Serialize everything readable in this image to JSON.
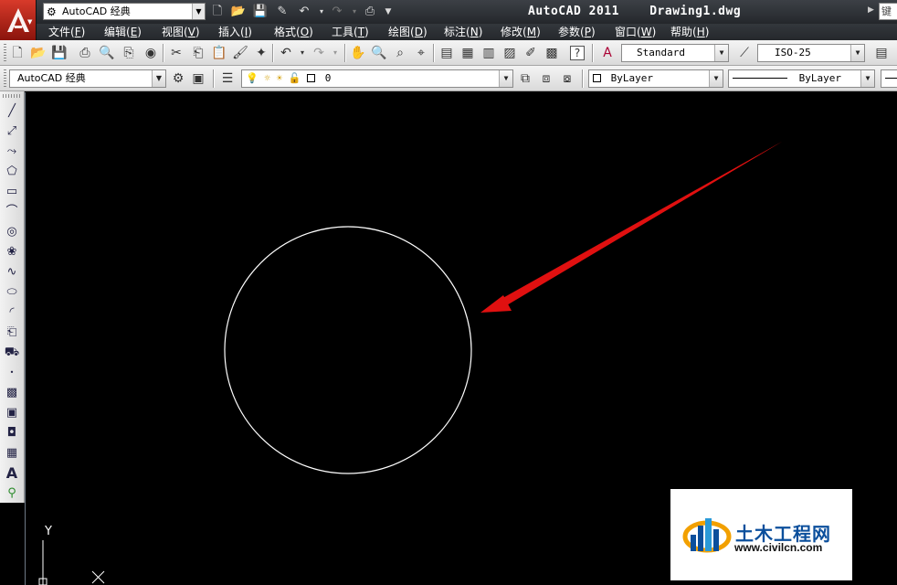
{
  "titlebar": {
    "workspace": "AutoCAD 经典",
    "title": "AutoCAD 2011    Drawing1.dwg",
    "search": "键"
  },
  "menu": [
    {
      "label": "文件",
      "key": "F"
    },
    {
      "label": "编辑",
      "key": "E"
    },
    {
      "label": "视图",
      "key": "V"
    },
    {
      "label": "插入",
      "key": "I"
    },
    {
      "label": "格式",
      "key": "O"
    },
    {
      "label": "工具",
      "key": "T"
    },
    {
      "label": "绘图",
      "key": "D"
    },
    {
      "label": "标注",
      "key": "N"
    },
    {
      "label": "修改",
      "key": "M"
    },
    {
      "label": "参数",
      "key": "P"
    },
    {
      "label": "窗口",
      "key": "W"
    },
    {
      "label": "帮助",
      "key": "H"
    }
  ],
  "toolbar1": {
    "text_style": "Standard",
    "dim_style": "ISO-25"
  },
  "toolbar2": {
    "workspace": "AutoCAD 经典",
    "layer": "0",
    "color": "ByLayer",
    "linetype": "ByLayer"
  },
  "canvas": {
    "ucs_y": "Y",
    "ucs_x": "X",
    "circle_color": "#ffffff",
    "arrow_color": "#e01010"
  },
  "watermark": {
    "text": "土木工程网",
    "url": "www.civilcn.com"
  },
  "colors": {
    "titlebar": "#2b2e33",
    "canvas": "#000000",
    "logo": "#c62c1e",
    "watermark_blue": "#0b4f9c"
  }
}
